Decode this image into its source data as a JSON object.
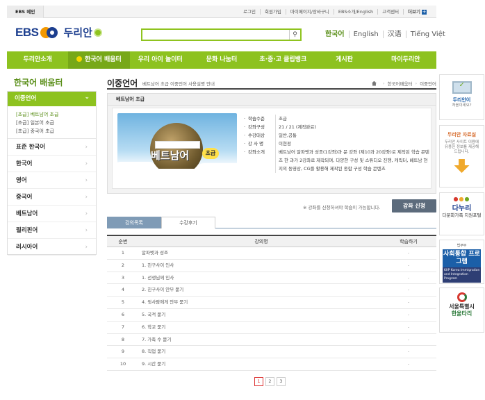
{
  "topbar": {
    "home": "EBS 메인",
    "links": [
      "로그인",
      "회원가입",
      "마이페이지/장바구니",
      "EBS소개/English",
      "고객센터",
      "더보기"
    ]
  },
  "header": {
    "logo_ebs": "EBS",
    "logo_name": "두리안",
    "search_placeholder": "",
    "langs": [
      "한국어",
      "English",
      "汉语",
      "Tiếng Việt"
    ]
  },
  "mainnav": [
    "두리안소개",
    "한국어 배움터",
    "우리 아이 놀이터",
    "문화 나눔터",
    "초·중·고 클립뱅크",
    "게시판",
    "마이두리안"
  ],
  "sidebar": {
    "title": "한국어 배움터",
    "active": "이중언어",
    "subitems": [
      "[초급] 베트남어 초급",
      "[초급] 일본어 초급",
      "[초급] 중국어 초급"
    ],
    "items": [
      "표준 한국어",
      "한국어",
      "영어",
      "중국어",
      "베트남어",
      "필리핀어",
      "러시아어"
    ]
  },
  "content": {
    "title": "이중언어",
    "desc": "베트남어 초급 이중언어 사용설명 안내",
    "breadcrumb": [
      "한국어배움터",
      "이중언어"
    ],
    "course_header": "베트남어 초급",
    "thumb_title": "베트남어",
    "thumb_badge": "초급",
    "thumb_banner": "이중언어 베트남어",
    "info": [
      {
        "k": "학습수준",
        "v": "초급"
      },
      {
        "k": "강좌구성",
        "v": "21 / 21 (제작완료)"
      },
      {
        "k": "수강대상",
        "v": "일반,공통"
      },
      {
        "k": "강 사 명",
        "v": "이현정"
      },
      {
        "k": "강좌소개",
        "v": "베트남어 알파벳과 성조(1강좌)과 문 강좌 (제10과 20강좌)로 제작된 학습 콘텐츠 한 과가 2강좌로 제작되며, 다양한 구성 및 스튜디오 진행, 캐릭터, 베트남 현지의 동영상, CG를 활용해 제작된 종합 구성 학습 콘텐츠"
      }
    ],
    "notice": "※ 강좌를 신청하셔야 학습이 가능합니다.",
    "apply": "강좌 신청",
    "tabs": [
      "강의목록",
      "수강후기"
    ],
    "table_headers": [
      "순번",
      "강의명",
      "학습하기"
    ],
    "rows": [
      {
        "no": "1",
        "name": "알파벳과 성조",
        "act": "-"
      },
      {
        "no": "2",
        "name": "1. 친구사이 인사",
        "act": "-"
      },
      {
        "no": "3",
        "name": "1. 선생님께 인사",
        "act": "-"
      },
      {
        "no": "4",
        "name": "2. 친구사이 안부 묻기",
        "act": "-"
      },
      {
        "no": "5",
        "name": "4. 윗사람에게 안부 묻기",
        "act": "-"
      },
      {
        "no": "6",
        "name": "5. 국적 묻기",
        "act": "-"
      },
      {
        "no": "7",
        "name": "6. 학교 묻기",
        "act": "-"
      },
      {
        "no": "8",
        "name": "7. 가족 수 묻기",
        "act": "-"
      },
      {
        "no": "9",
        "name": "8. 직업 묻기",
        "act": "-"
      },
      {
        "no": "10",
        "name": "9. 시간 묻기",
        "act": "-"
      }
    ],
    "pages": [
      "1",
      "2",
      "3"
    ]
  },
  "banners": {
    "b1_title": "두리안이",
    "b1_sub": "처음이세요?",
    "b2_title": "두리안 자료실",
    "b2_sub": "두리안 사이트 이용에 유용한 정보를 제공해 드립니다.",
    "b3_logo": "다누리",
    "b3_sub": "다문화가족 지원포털",
    "b4_top": "법무부",
    "b4_main": "사회통합 프로그램",
    "b4_sub": "KIIP Korea Immigration and Integration Program",
    "b5_l1": "서울특별시",
    "b5_l2": "한울타리"
  }
}
